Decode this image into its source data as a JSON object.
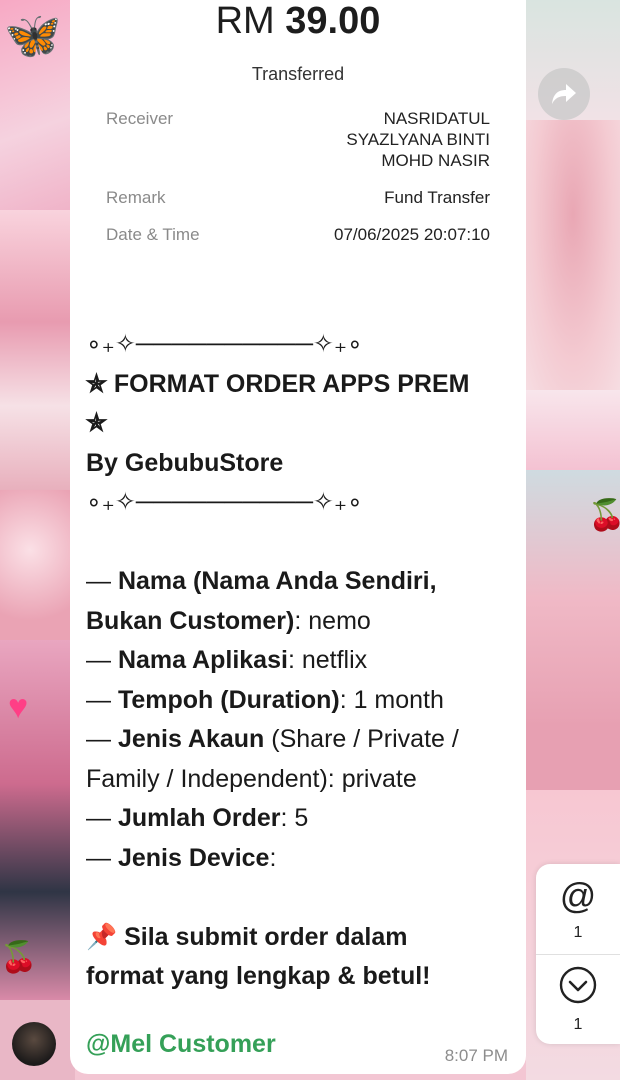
{
  "receipt": {
    "currency": "RM",
    "amount": "39.00",
    "status": "Transferred",
    "receiver_label": "Receiver",
    "receiver_lines": [
      "NASRIDATUL",
      "SYAZLYANA BINTI",
      "MOHD NASIR"
    ],
    "remark_label": "Remark",
    "remark_value": "Fund Transfer",
    "datetime_label": "Date & Time",
    "datetime_value": "07/06/2025 20:07:10"
  },
  "message": {
    "divider": "∘₊✧──────────✧₊∘",
    "title_line1": "✯ FORMAT ORDER APPS PREM",
    "title_line2": "✯",
    "byline": "By GebubuStore",
    "fields": [
      {
        "bold": "Nama (Nama Anda Sendiri,",
        "rest": ""
      },
      {
        "bold": "Bukan Customer)",
        "rest": ": nemo"
      },
      {
        "bold": "Nama Aplikasi",
        "rest": ": netflix"
      },
      {
        "bold": "Tempoh (Duration)",
        "rest": ": 1 month"
      },
      {
        "bold": "Jenis Akaun",
        "rest": " (Share / Private /"
      },
      {
        "bold": "",
        "rest": "Family / Independent): private"
      },
      {
        "bold": "Jumlah Order",
        "rest": ": 5"
      },
      {
        "bold": "Jenis Device",
        "rest": ":"
      }
    ],
    "dash": "— ",
    "note_line1": "📌 Sila submit order dalam",
    "note_line2": "format yang lengkap & betul!",
    "sender": "@Mel Customer",
    "time": "8:07 PM"
  },
  "controls": {
    "mention_icon": "at-sign-icon",
    "mention_count": "1",
    "scroll_icon": "chevron-down-icon",
    "scroll_count": "1",
    "forward_icon": "forward-arrow-icon"
  }
}
